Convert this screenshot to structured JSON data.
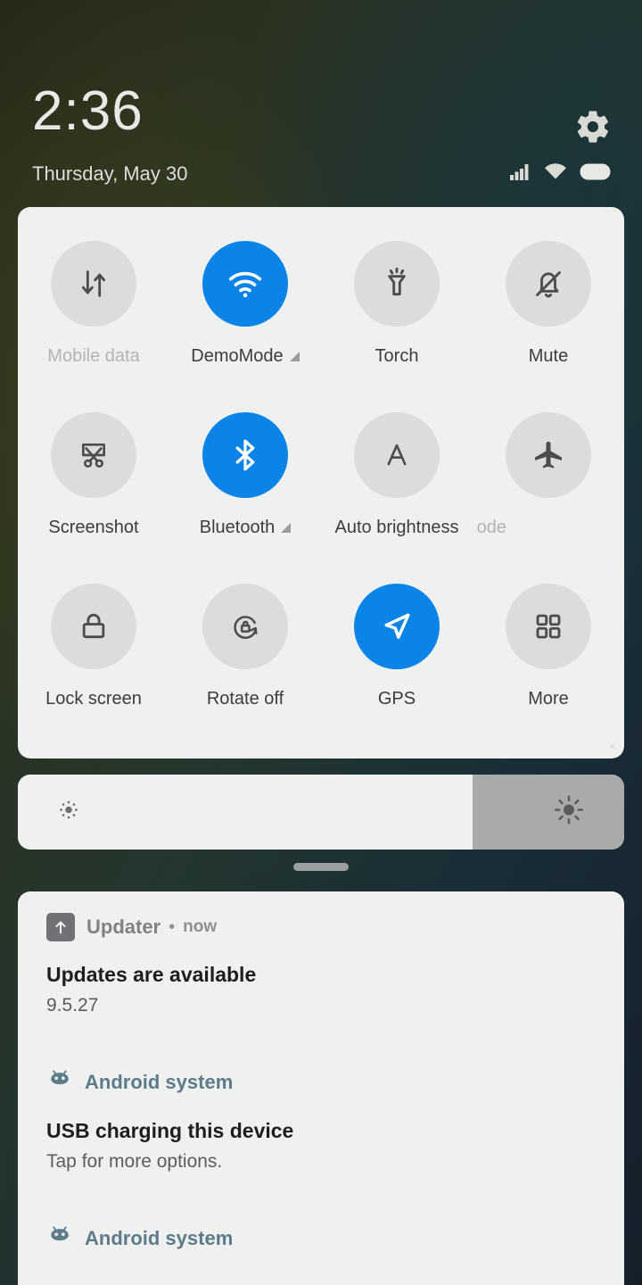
{
  "status": {
    "clock": "2:36",
    "date": "Thursday, May 30",
    "settings_icon": "gear-icon",
    "signal_icon": "signal-bars-icon",
    "wifi_icon": "wifi-icon",
    "battery_icon": "battery-full-icon"
  },
  "quick_settings": {
    "tiles": [
      {
        "label": "Mobile data",
        "icon": "mobile-data-icon",
        "active": false,
        "disabled": true,
        "expandable": false
      },
      {
        "label": "DemoMode",
        "icon": "wifi-icon",
        "active": true,
        "disabled": false,
        "expandable": true
      },
      {
        "label": "Torch",
        "icon": "flashlight-icon",
        "active": false,
        "disabled": false,
        "expandable": false
      },
      {
        "label": "Mute",
        "icon": "bell-muted-icon",
        "active": false,
        "disabled": false,
        "expandable": false
      },
      {
        "label": "Screenshot",
        "icon": "scissors-icon",
        "active": false,
        "disabled": false,
        "expandable": false
      },
      {
        "label": "Bluetooth",
        "icon": "bluetooth-icon",
        "active": true,
        "disabled": false,
        "expandable": true
      },
      {
        "label": "Auto brightness",
        "icon": "auto-brightness-icon",
        "active": false,
        "disabled": false,
        "expandable": false
      },
      {
        "label": "ane mode",
        "icon": "airplane-icon",
        "active": false,
        "disabled": false,
        "expandable": false
      },
      {
        "label": "Lock screen",
        "icon": "padlock-icon",
        "active": false,
        "disabled": false,
        "expandable": false
      },
      {
        "label": "Rotate off",
        "icon": "rotation-lock-icon",
        "active": false,
        "disabled": false,
        "expandable": false
      },
      {
        "label": "GPS",
        "icon": "navigation-arrow-icon",
        "active": true,
        "disabled": false,
        "expandable": false
      },
      {
        "label": "More",
        "icon": "grid-squares-icon",
        "active": false,
        "disabled": false,
        "expandable": false
      }
    ]
  },
  "brightness": {
    "level_percent": 75,
    "low_icon": "sun-small-icon",
    "high_icon": "sun-large-icon"
  },
  "drag_handle": "notification-drag-handle",
  "notifications": [
    {
      "app": "Updater",
      "icon": "upload-arrow-icon",
      "separator": "•",
      "when": "now",
      "title": "Updates are available",
      "body": "9.5.27",
      "android_style": false
    },
    {
      "app": "Android system",
      "icon": "android-head-icon",
      "separator": "",
      "when": "",
      "title": "USB charging this device",
      "body": "Tap for more options.",
      "android_style": true
    },
    {
      "app": "Android system",
      "icon": "android-head-icon",
      "separator": "",
      "when": "",
      "title": "",
      "body": "",
      "android_style": true
    }
  ],
  "colors": {
    "accent_active": "#0b84e8",
    "panel_bg": "#eff0f0",
    "tile_bg": "#dcdcdc",
    "android_blue": "#5d7b89"
  }
}
